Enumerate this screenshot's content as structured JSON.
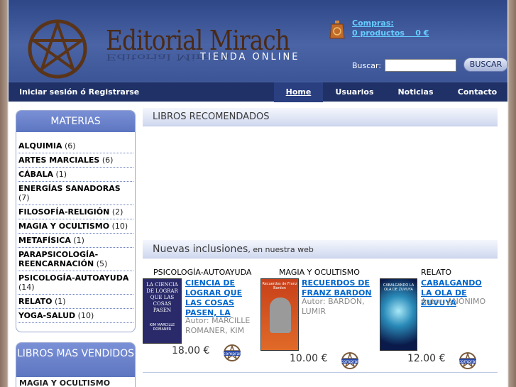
{
  "header": {
    "brand": "Editorial Mirach",
    "tagline": "TIENDA ONLINE",
    "cart_label": "Compras:",
    "cart_amount": "0 productos    0 €",
    "search_label": "Buscar:",
    "search_value": "",
    "search_button": "BUSCAR"
  },
  "nav": {
    "login": "Iniciar sesión ó Registrarse",
    "items": [
      "Home",
      "Usuarios",
      "Noticias",
      "Contacto"
    ],
    "active": "Home"
  },
  "sidebar": {
    "materias_title": "MATERIAS",
    "categories": [
      {
        "name": "ALQUIMIA",
        "count": "(6)"
      },
      {
        "name": "ARTES MARCIALES",
        "count": "(6)"
      },
      {
        "name": "CÁBALA",
        "count": "(1)"
      },
      {
        "name": "ENERGÍAS SANADORAS",
        "count": "(7)"
      },
      {
        "name": "FILOSOFÍA-RELIGIÓN",
        "count": "(2)"
      },
      {
        "name": "MAGIA Y OCULTISMO",
        "count": "(10)"
      },
      {
        "name": "METAFÍSICA",
        "count": "(1)"
      },
      {
        "name": "PARAPSICOLOGÍA-REENCARNACIÓN",
        "count": "(5)"
      },
      {
        "name": "PSICOLOGÍA-AUTOAYUDA",
        "count": "(14)"
      },
      {
        "name": "RELATO",
        "count": "(1)"
      },
      {
        "name": "YOGA-SALUD",
        "count": "(10)"
      }
    ],
    "bestsellers_title": "LIBROS MAS VENDIDOS",
    "bestsellers": [
      "MAGIA Y OCULTISMO"
    ]
  },
  "main": {
    "recommended_title": "LIBROS RECOMENDADOS",
    "new_title": "Nuevas inclusiones",
    "new_subtitle": ", en nuestra web",
    "books": [
      {
        "category": "PSICOLOGÍA-AUTOAYUDA",
        "title": "CIENCIA DE LOGRAR QUE LAS COSAS PASEN, LA",
        "author": "Autor: MARCILLE ROMANER, KIM",
        "price": "18.00 €",
        "cover_text": "LA CIENCIA DE LOGRAR QUE LAS COSAS PASEN",
        "cover_author": "KIM MARCILLE ROMANER"
      },
      {
        "category": "MAGIA Y OCULTISMO",
        "title": "RECUERDOS DE FRANZ BARDON",
        "author": "Autor: BARDON, LUMIR",
        "price": "10.00 €",
        "cover_text": "Recuerdos de Franz Bardon",
        "cover_author": ""
      },
      {
        "category": "RELATO",
        "title": "CABALGANDO LA OLA DE ZUVUYA",
        "author": "Autor: ANÓNIMO",
        "price": "12.00 €",
        "cover_text": "CABALGANDO LA OLA DE ZUVUYA",
        "cover_author": ""
      }
    ]
  },
  "colors": {
    "header_blue": "#3c5597",
    "nav_blue": "#1f3166",
    "link_blue": "#0066cc",
    "cart_cyan": "#66ccff",
    "logo_brown": "#4a2a16"
  },
  "icons": [
    "pentagram-logo-icon",
    "cart-icon",
    "buy-icon"
  ]
}
